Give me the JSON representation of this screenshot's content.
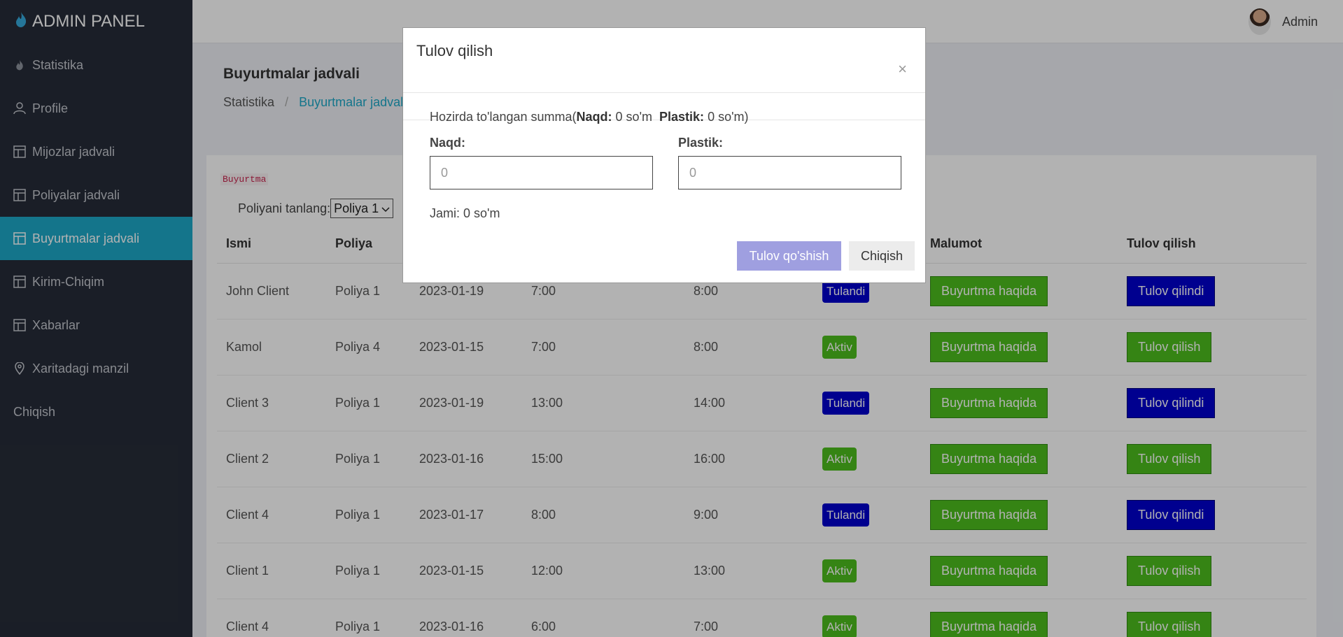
{
  "brand": {
    "title": "ADMIN PANEL",
    "icon": "fire-icon"
  },
  "sidebar": {
    "items": [
      {
        "label": "Statistika",
        "icon": "fire-icon"
      },
      {
        "label": "Profile",
        "icon": "user-icon"
      },
      {
        "label": "Mijozlar jadvali",
        "icon": "table-icon"
      },
      {
        "label": "Poliyalar jadvali",
        "icon": "table-icon"
      },
      {
        "label": "Buyurtmalar jadvali",
        "icon": "table-icon",
        "active": true
      },
      {
        "label": "Kirim-Chiqim",
        "icon": "table-icon"
      },
      {
        "label": "Xabarlar",
        "icon": "table-icon"
      },
      {
        "label": "Xaritadagi manzil",
        "icon": "map-pin-icon"
      },
      {
        "label": "Chiqish"
      }
    ]
  },
  "topbar": {
    "username": "Admin"
  },
  "header": {
    "title": "Buyurtmalar jadvali",
    "breadcrumb_root": "Statistika",
    "breadcrumb_sep": "/",
    "breadcrumb_current": "Buyurtmalar jadvali"
  },
  "main": {
    "tag": "Buyurtma",
    "select_label": "Poliyani tanlang:",
    "select_value": "Poliya 1",
    "columns": [
      "Ismi",
      "Poliya",
      "",
      "",
      "",
      "",
      "Malumot",
      "Tulov qilish"
    ],
    "rows": [
      {
        "name": "John Client",
        "poliya": "Poliya 1",
        "date": "2023-01-19",
        "start": "7:00",
        "end": "8:00",
        "status": "Tulandi",
        "info": "Buyurtma haqida",
        "pay": "Tulov qilindi"
      },
      {
        "name": "Kamol",
        "poliya": "Poliya 4",
        "date": "2023-01-15",
        "start": "7:00",
        "end": "8:00",
        "status": "Aktiv",
        "info": "Buyurtma haqida",
        "pay": "Tulov qilish"
      },
      {
        "name": "Client 3",
        "poliya": "Poliya 1",
        "date": "2023-01-19",
        "start": "13:00",
        "end": "14:00",
        "status": "Tulandi",
        "info": "Buyurtma haqida",
        "pay": "Tulov qilindi"
      },
      {
        "name": "Client 2",
        "poliya": "Poliya 1",
        "date": "2023-01-16",
        "start": "15:00",
        "end": "16:00",
        "status": "Aktiv",
        "info": "Buyurtma haqida",
        "pay": "Tulov qilish"
      },
      {
        "name": "Client 4",
        "poliya": "Poliya 1",
        "date": "2023-01-17",
        "start": "8:00",
        "end": "9:00",
        "status": "Tulandi",
        "info": "Buyurtma haqida",
        "pay": "Tulov qilindi"
      },
      {
        "name": "Client 1",
        "poliya": "Poliya 1",
        "date": "2023-01-15",
        "start": "12:00",
        "end": "13:00",
        "status": "Aktiv",
        "info": "Buyurtma haqida",
        "pay": "Tulov qilish"
      },
      {
        "name": "Client 4",
        "poliya": "Poliya 1",
        "date": "2023-01-16",
        "start": "6:00",
        "end": "7:00",
        "status": "Aktiv",
        "info": "Buyurtma haqida",
        "pay": "Tulov qilish"
      }
    ]
  },
  "modal": {
    "title": "Tulov qilish",
    "close": "×",
    "current_prefix": "Hozirda to'langan summa(",
    "cash_label_inline": "Naqd:",
    "cash_value_inline": "0 so'm",
    "card_label_inline": "Plastik:",
    "card_value_inline": "0 so'm)",
    "cash_label": "Naqd:",
    "cash_placeholder": "0",
    "card_label": "Plastik:",
    "card_placeholder": "0",
    "total": "Jami: 0 so'm",
    "submit": "Tulov qo'shish",
    "exit": "Chiqish"
  },
  "colors": {
    "accent": "#1da8c7",
    "paid": "#0000cd",
    "active": "#4cbe1e",
    "sidebar": "#262c38"
  }
}
